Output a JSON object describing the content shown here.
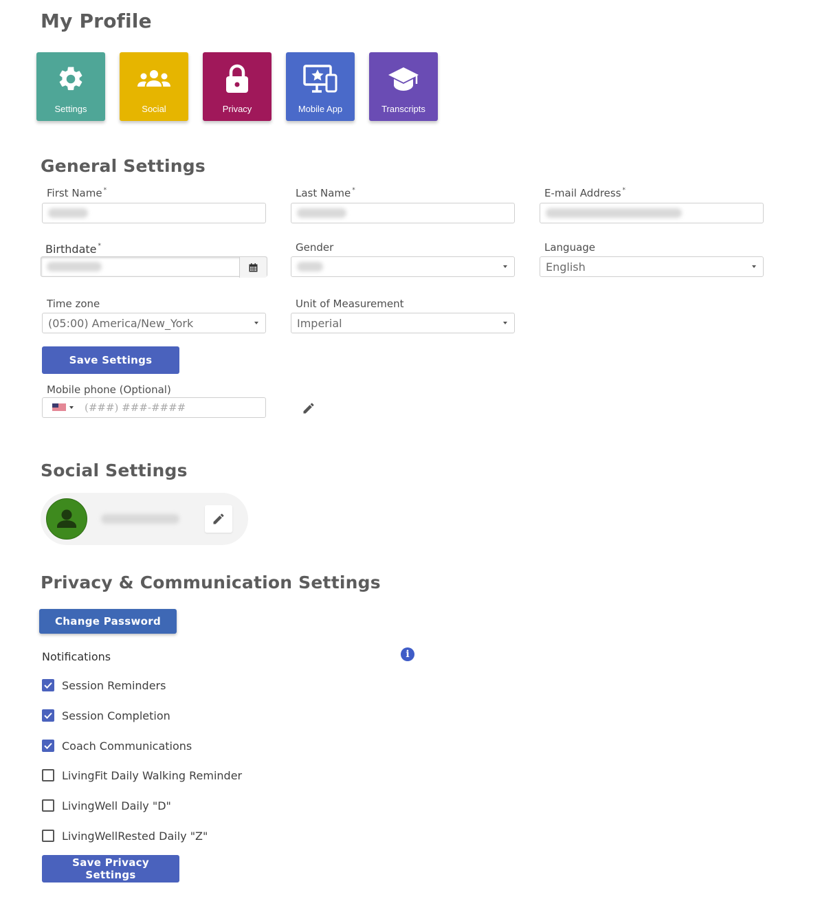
{
  "page": {
    "title": "My Profile"
  },
  "tiles": [
    {
      "label": "Settings",
      "icon": "gear-icon",
      "color": "#4fa697"
    },
    {
      "label": "Social",
      "icon": "people-icon",
      "color": "#e6b500"
    },
    {
      "label": "Privacy",
      "icon": "lock-icon",
      "color": "#a0185a"
    },
    {
      "label": "Mobile App",
      "icon": "devices-star-icon",
      "color": "#4a6ac9"
    },
    {
      "label": "Transcripts",
      "icon": "graduation-cap-icon",
      "color": "#6a4cb4"
    }
  ],
  "general": {
    "title": "General Settings",
    "first_name_label": "First Name",
    "last_name_label": "Last Name",
    "email_label": "E-mail Address",
    "birthdate_label": "Birthdate",
    "gender_label": "Gender",
    "language_label": "Language",
    "language_value": "English",
    "timezone_label": "Time zone",
    "timezone_value": "(05:00) America/New_York",
    "unit_label": "Unit of Measurement",
    "unit_value": "Imperial",
    "save_label": "Save Settings",
    "phone_label": "Mobile phone (Optional)",
    "phone_placeholder": "(###) ###-####",
    "required_mark": "*"
  },
  "social": {
    "title": "Social Settings"
  },
  "privacy": {
    "title": "Privacy & Communication Settings",
    "change_password_label": "Change Password",
    "notifications_label": "Notifications",
    "items": [
      {
        "label": "Session Reminders",
        "checked": true
      },
      {
        "label": "Session Completion",
        "checked": true
      },
      {
        "label": "Coach Communications",
        "checked": true
      },
      {
        "label": "LivingFit Daily Walking Reminder",
        "checked": false
      },
      {
        "label": "LivingWell Daily \"D\"",
        "checked": false
      },
      {
        "label": "LivingWellRested Daily \"Z\"",
        "checked": false
      }
    ],
    "save_label": "Save Privacy Settings"
  },
  "colors": {
    "accent": "#4a62bd",
    "avatar_green": "#3e8a1e"
  }
}
